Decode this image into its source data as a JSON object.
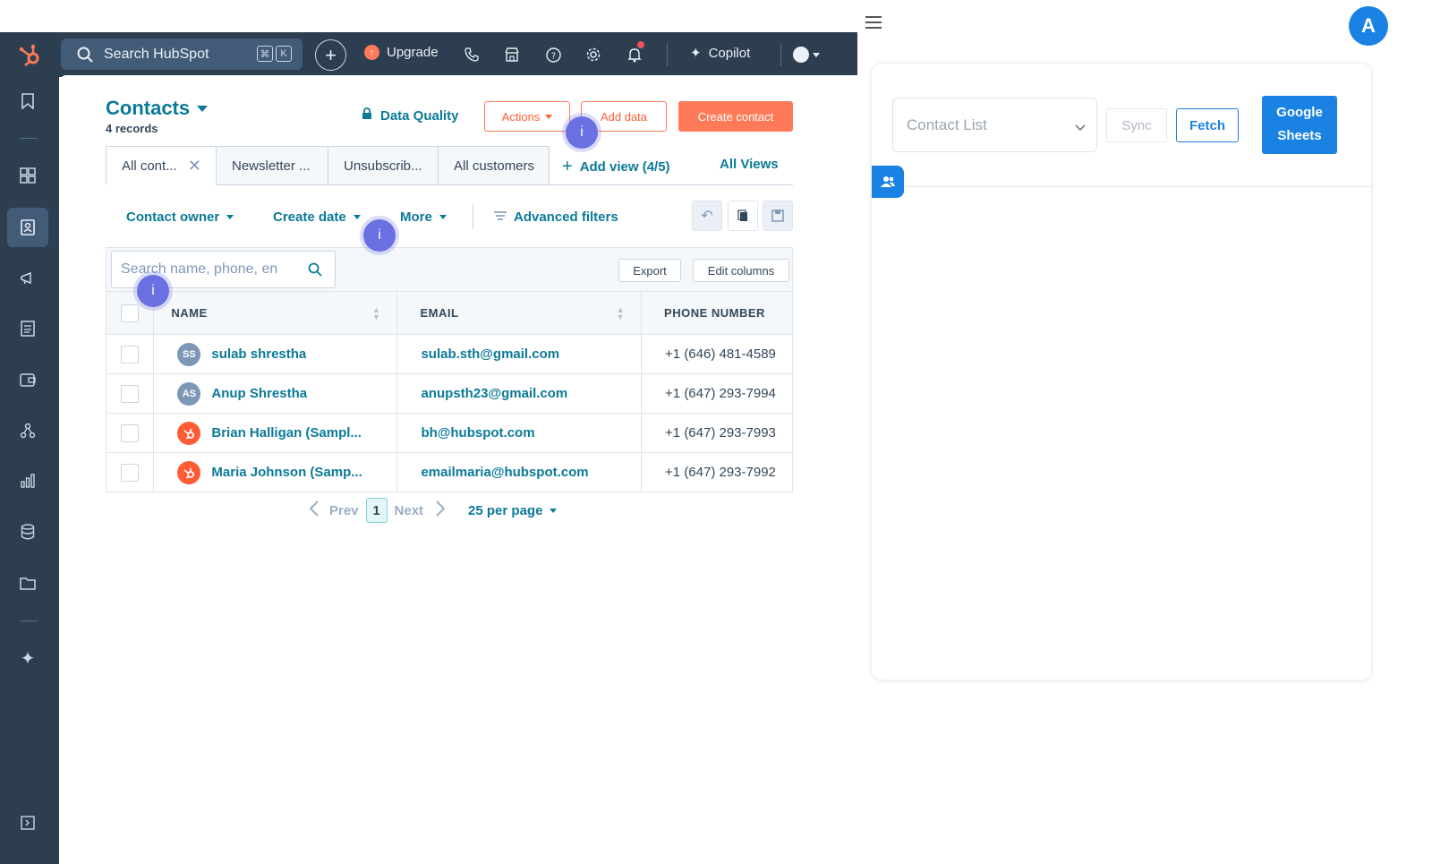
{
  "topnav": {
    "search_placeholder": "Search HubSpot",
    "kbd": [
      "⌘",
      "K"
    ],
    "upgrade": "Upgrade",
    "copilot": "Copilot"
  },
  "contacts": {
    "title": "Contacts",
    "subtitle": "4 records",
    "data_quality": "Data Quality",
    "actions": "Actions",
    "add_data": "Add data",
    "create_contact": "Create contact"
  },
  "tabs": [
    "All cont...",
    "Newsletter ...",
    "Unsubscrib...",
    "All customers"
  ],
  "add_view": "Add view (4/5)",
  "all_views": "All Views",
  "filters": {
    "owner": "Contact owner",
    "create_date": "Create date",
    "more": "More",
    "advanced": "Advanced filters"
  },
  "table": {
    "search_placeholder": "Search name, phone, en",
    "export": "Export",
    "edit_columns": "Edit columns",
    "headers": [
      "NAME",
      "EMAIL",
      "PHONE NUMBER"
    ],
    "rows": [
      {
        "initials": "SS",
        "name": "sulab shrestha",
        "email": "sulab.sth@gmail.com",
        "phone": "+1 (646) 481-4589"
      },
      {
        "initials": "AS",
        "name": "Anup Shrestha",
        "email": "anupsth23@gmail.com",
        "phone": "+1 (647) 293-7994"
      },
      {
        "initials": "",
        "name": "Brian Halligan (Sampl...",
        "email": "bh@hubspot.com",
        "phone": "+1 (647) 293-7993"
      },
      {
        "initials": "",
        "name": "Maria Johnson (Samp...",
        "email": "emailmaria@hubspot.com",
        "phone": "+1 (647) 293-7992"
      }
    ]
  },
  "pager": {
    "prev": "Prev",
    "page": "1",
    "next": "Next",
    "per_page": "25 per page"
  },
  "hotspot": "i",
  "user_initial": "A",
  "panel": {
    "select": "Contact List",
    "sync": "Sync",
    "fetch": "Fetch",
    "google_sheets_line1": "Google",
    "google_sheets_line2": "Sheets"
  },
  "colors": {
    "brand_orange": "#ff7a59",
    "link_teal": "#0b7a98",
    "nav_dark": "#2d3e50",
    "panel_blue": "#1a82e2"
  }
}
